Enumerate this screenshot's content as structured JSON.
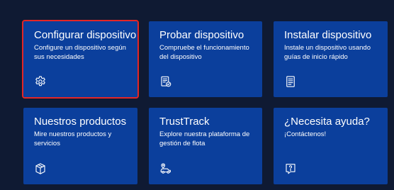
{
  "tiles": [
    {
      "title": "Configurar dispositivo",
      "description": "Configure un dispositivo según sus necesidades",
      "icon": "gear-icon",
      "selected": true
    },
    {
      "title": "Probar dispositivo",
      "description": "Compruebe el funcionamiento del dispositivo",
      "icon": "document-check-icon",
      "selected": false
    },
    {
      "title": "Instalar dispositivo",
      "description": "Instale un dispositivo usando guías de inicio rápido",
      "icon": "guide-document-icon",
      "selected": false
    },
    {
      "title": "Nuestros productos",
      "description": "Mire nuestros productos y servicios",
      "icon": "product-box-icon",
      "selected": false
    },
    {
      "title": "TrustTrack",
      "description": "Explore nuestra plataforma de gestión de flota",
      "icon": "vehicle-tracking-icon",
      "selected": false
    },
    {
      "title": "¿Necesita ayuda?",
      "description": "¡Contáctenos!",
      "icon": "help-question-icon",
      "selected": false
    }
  ],
  "colors": {
    "background": "#0f1a33",
    "tile": "#0b3f9c",
    "selected_border": "#e32626",
    "text": "#ffffff"
  }
}
